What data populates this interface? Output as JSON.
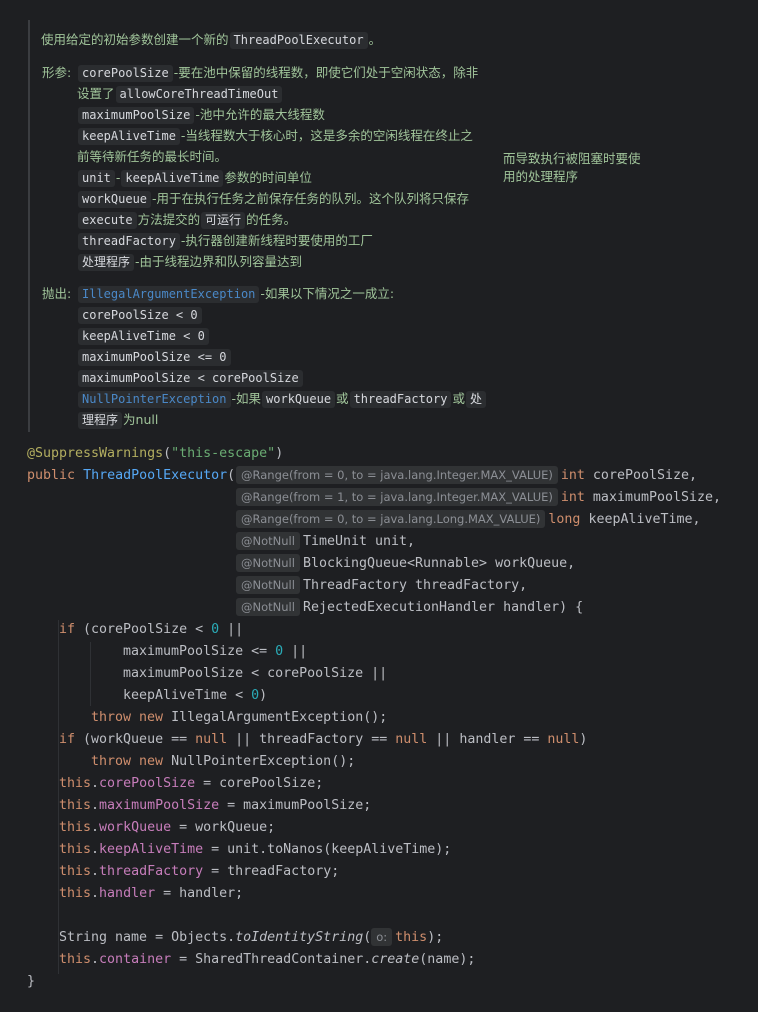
{
  "doc": {
    "intro_prefix": "使用给定的初始参数创建一个新的",
    "intro_chip": "ThreadPoolExecutor",
    "intro_suffix": "。",
    "params_label": "形参:",
    "p1_chip": "corePoolSize",
    "p1_text": "-要在池中保留的线程数，即使它们处于空闲状态，除非",
    "p1b_prefix": "设置了",
    "p1b_chip": "allowCoreThreadTimeOut",
    "p2_chip": "maximumPoolSize",
    "p2_text": "-池中允许的最大线程数",
    "p3_chip": "keepAliveTime",
    "p3_text": "-当线程数大于核心时，这是多余的空闲线程在终止之",
    "p3b_text": "前等待新任务的最长时间。",
    "side_note_1": "而导致执行被阻塞时要使",
    "side_note_2": "用的处理程序",
    "p4_chip1": "unit",
    "p4_sep": "-",
    "p4_chip2": "keepAliveTime",
    "p4_text": "参数的时间单位",
    "p5_chip": "workQueue",
    "p5_text": "-用于在执行任务之前保存任务的队列。这个队列将只保存",
    "p5b_chip1": "execute",
    "p5b_text1": "方法提交的",
    "p5b_chip2": "可运行",
    "p5b_text2": "的任务。",
    "p6_chip": "threadFactory",
    "p6_text": "-执行器创建新线程时要使用的工厂",
    "p7_chip": "处理程序",
    "p7_text": "-由于线程边界和队列容量达到",
    "throws_label": "抛出:",
    "t1_chip": "IllegalArgumentException",
    "t1_text": "-如果以下情况之一成立:",
    "t1_c1": "corePoolSize < 0",
    "t1_c2": "keepAliveTime < 0",
    "t1_c3": "maximumPoolSize <= 0",
    "t1_c4": "maximumPoolSize < corePoolSize",
    "t2_chip": "NullPointerException",
    "t2_text1": "-如果",
    "t2_chip2": "workQueue",
    "t2_or1": "或",
    "t2_chip3": "threadFactory",
    "t2_or2": "或",
    "t2_chip4": "处",
    "t2b_chip": "理程序",
    "t2b_text": "为null"
  },
  "code": {
    "l1_ann": "@SuppressWarnings",
    "l1_paren_open": "(",
    "l1_str": "\"this-escape\"",
    "l1_paren_close": ")",
    "l2_kw": "public",
    "l2_name": "ThreadPoolExecutor",
    "l2_open": "(",
    "l2_hint": "@Range(from = 0, to = java.lang.Integer.MAX_VALUE)",
    "l2_type": "int",
    "l2_param": " corePoolSize,",
    "l3_hint": "@Range(from = 1, to = java.lang.Integer.MAX_VALUE)",
    "l3_type": "int",
    "l3_param": " maximumPoolSize,",
    "l4_hint": "@Range(from = 0, to = java.lang.Long.MAX_VALUE)",
    "l4_type": "long",
    "l4_param": " keepAliveTime,",
    "l5_hint": "@NotNull",
    "l5_param": "TimeUnit unit,",
    "l6_hint": "@NotNull",
    "l6_param": "BlockingQueue<Runnable> workQueue,",
    "l7_hint": "@NotNull",
    "l7_param": "ThreadFactory threadFactory,",
    "l8_hint": "@NotNull",
    "l8_param": "RejectedExecutionHandler handler) {",
    "l9_kw": "if",
    "l9_a": " (corePoolSize < ",
    "l9_num": "0",
    "l9_b": " ||",
    "l10_a": "maximumPoolSize <= ",
    "l10_num": "0",
    "l10_b": " ||",
    "l11": "maximumPoolSize < corePoolSize ||",
    "l12_a": "keepAliveTime < ",
    "l12_num": "0",
    "l12_b": ")",
    "l13_kw1": "throw",
    "l13_kw2": "new",
    "l13_rest": " IllegalArgumentException();",
    "l14_kw": "if",
    "l14_a": " (workQueue == ",
    "l14_null1": "null",
    "l14_b": " || threadFactory == ",
    "l14_null2": "null",
    "l14_c": " || handler == ",
    "l14_null3": "null",
    "l14_d": ")",
    "l15_kw1": "throw",
    "l15_kw2": "new",
    "l15_rest": " NullPointerException();",
    "this_kw": "this",
    "l16_field": "corePoolSize",
    "l16_rest": " = corePoolSize;",
    "l17_field": "maximumPoolSize",
    "l17_rest": " = maximumPoolSize;",
    "l18_field": "workQueue",
    "l18_rest": " = workQueue;",
    "l19_field": "keepAliveTime",
    "l19_rest": " = unit.toNanos(keepAliveTime);",
    "l20_field": "threadFactory",
    "l20_rest": " = threadFactory;",
    "l21_field": "handler",
    "l21_rest": " = handler;",
    "l22_a": "String name = Objects.",
    "l22_method": "toIdentityString",
    "l22_open": "(",
    "l22_hint": "o:",
    "l22_this": "this",
    "l22_close": ");",
    "l23_field": "container",
    "l23_a": " = SharedThreadContainer.",
    "l23_method": "create",
    "l23_b": "(name);",
    "l24": "}"
  },
  "colors": {
    "background": "#1e1f22",
    "doc_text": "#5f9e6b",
    "keyword": "#cf8e6d",
    "field": "#c77dbb",
    "number": "#2aacb8",
    "string": "#6aab73",
    "annotation": "#b3ae60",
    "method_decl": "#56a8f5"
  }
}
